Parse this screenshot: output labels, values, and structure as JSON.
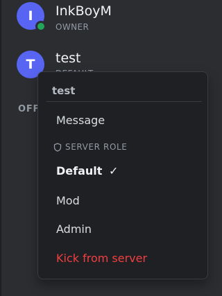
{
  "members": [
    {
      "name": "InkBoyM",
      "role": "OWNER",
      "initial": "I",
      "status": "online"
    },
    {
      "name": "test",
      "role": "DEFAULT",
      "initial": "T"
    }
  ],
  "section_header": "OFF",
  "context_menu": {
    "title": "test",
    "message_label": "Message",
    "server_role_label": "SERVER ROLE",
    "roles": [
      {
        "label": "Default",
        "selected": true,
        "check": "✓"
      },
      {
        "label": "Mod"
      },
      {
        "label": "Admin"
      }
    ],
    "kick_label": "Kick from server"
  },
  "colors": {
    "avatar_bg": "#5865f2",
    "online": "#23a559",
    "danger": "#f23f42",
    "panel_bg": "#2b2d31",
    "menu_bg": "#1f2023"
  },
  "icons": {
    "role_group": "shield-icon",
    "selected": "check-mark"
  }
}
